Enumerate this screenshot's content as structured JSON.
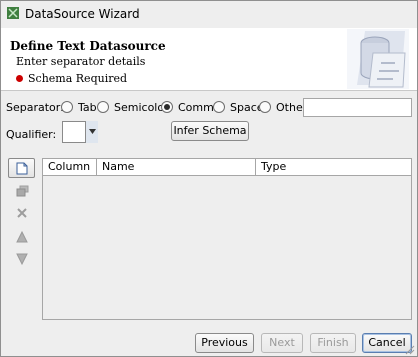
{
  "window": {
    "title": "DataSource Wizard"
  },
  "header": {
    "title": "Define Text Datasource",
    "subtitle": "Enter separator details",
    "status": "Schema Required",
    "status_color": "#cc0000"
  },
  "separator": {
    "label": "Separator:",
    "options": [
      {
        "label": "Tab",
        "selected": false
      },
      {
        "label": "Semicolon",
        "selected": false
      },
      {
        "label": "Comma",
        "selected": true
      },
      {
        "label": "Space",
        "selected": false
      },
      {
        "label": "Other",
        "selected": false
      }
    ],
    "other_value": ""
  },
  "qualifier": {
    "label": "Qualifier:",
    "value": ""
  },
  "infer_button": "Infer Schema",
  "table": {
    "columns": [
      "Column",
      "Name",
      "Type"
    ],
    "rows": []
  },
  "side_toolbar": [
    {
      "icon": "new-row-icon",
      "enabled": true
    },
    {
      "icon": "copy-icon",
      "enabled": false
    },
    {
      "icon": "delete-icon",
      "enabled": false
    },
    {
      "icon": "move-up-icon",
      "enabled": false
    },
    {
      "icon": "move-down-icon",
      "enabled": false
    }
  ],
  "buttons": {
    "previous": "Previous",
    "next": "Next",
    "finish": "Finish",
    "cancel": "Cancel"
  }
}
